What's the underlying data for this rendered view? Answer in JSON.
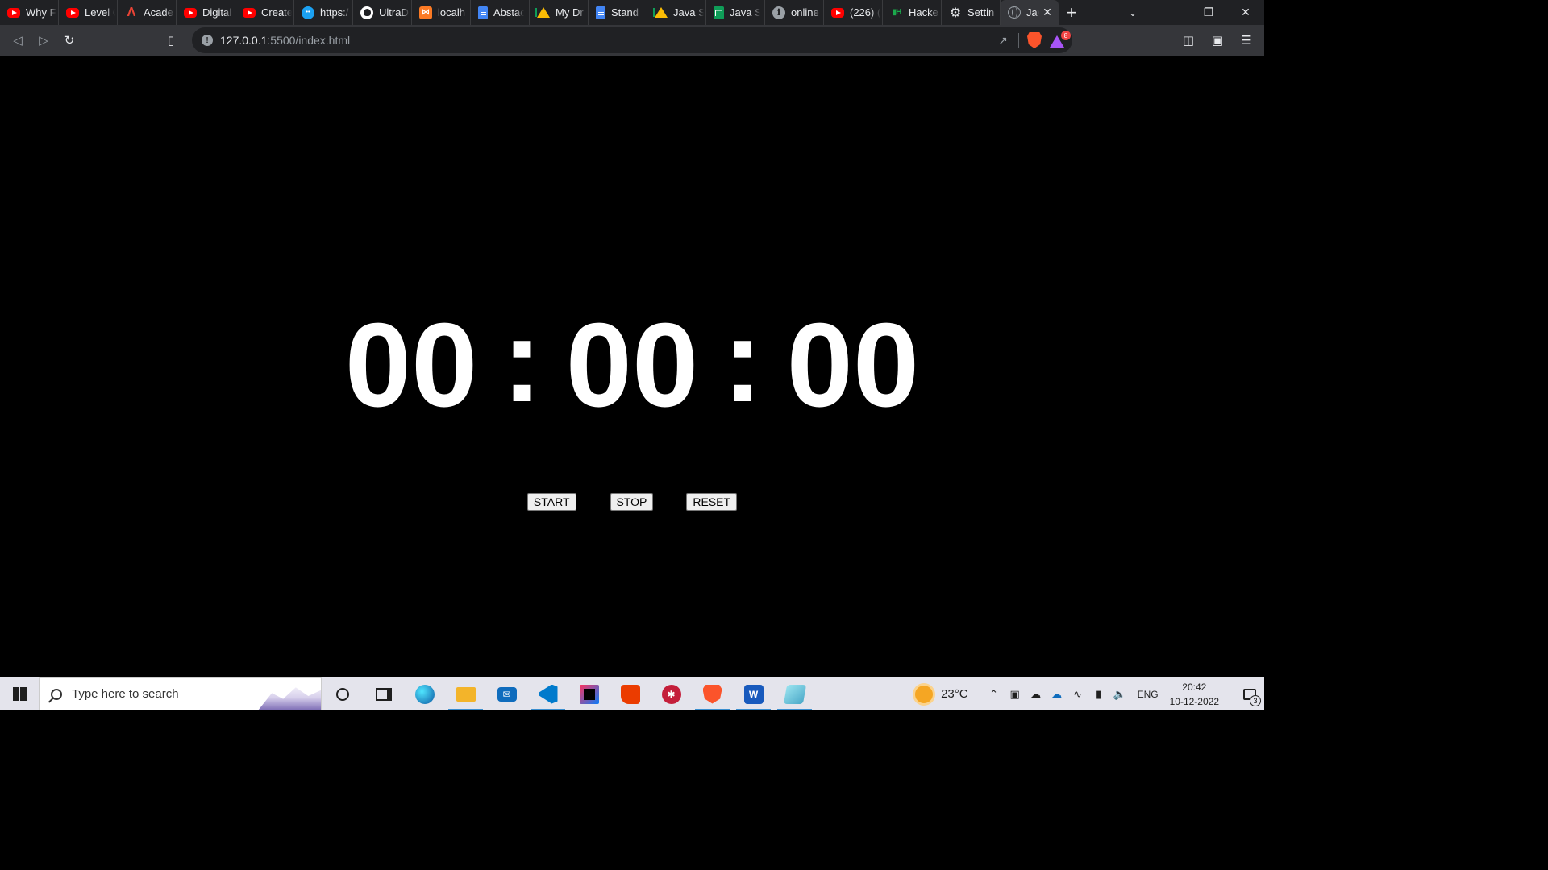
{
  "browser": {
    "tabs": [
      {
        "label": "Why F",
        "icon": "youtube-icon"
      },
      {
        "label": "Level C",
        "icon": "youtube-icon"
      },
      {
        "label": "Acade",
        "icon": "academy-icon"
      },
      {
        "label": "Digital",
        "icon": "youtube-icon"
      },
      {
        "label": "Create",
        "icon": "youtube-icon"
      },
      {
        "label": "https:/",
        "icon": "web-icon"
      },
      {
        "label": "UltraD",
        "icon": "github-icon"
      },
      {
        "label": "localh",
        "icon": "xampp-icon"
      },
      {
        "label": "Abstac",
        "icon": "google-docs-icon"
      },
      {
        "label": "My Dr",
        "icon": "google-drive-icon"
      },
      {
        "label": "Stand",
        "icon": "google-docs-icon"
      },
      {
        "label": "Java S",
        "icon": "google-drive-icon"
      },
      {
        "label": "Java S",
        "icon": "google-sheets-icon"
      },
      {
        "label": "online",
        "icon": "info-icon"
      },
      {
        "label": "(226) (",
        "icon": "youtube-icon"
      },
      {
        "label": "Hacke",
        "icon": "hackerrank-icon"
      },
      {
        "label": "Settin",
        "icon": "gear-icon"
      },
      {
        "label": "Jav",
        "icon": "globe-icon",
        "active": true
      }
    ],
    "url_host": "127.0.0.1",
    "url_path": ":5500/index.html",
    "rewards_badge": "8"
  },
  "page": {
    "hours": "00",
    "minutes": "00",
    "seconds": "00",
    "separator": ":",
    "start_label": "START",
    "stop_label": "STOP",
    "reset_label": "RESET"
  },
  "taskbar": {
    "search_placeholder": "Type here to search",
    "temperature": "23°C",
    "language": "ENG",
    "time": "20:42",
    "date": "10-12-2022",
    "notification_count": "3"
  },
  "colors": {
    "page_background": "#000000",
    "timer_text": "#ffffff",
    "browser_chrome": "#202124",
    "toolbar": "#35363a"
  }
}
